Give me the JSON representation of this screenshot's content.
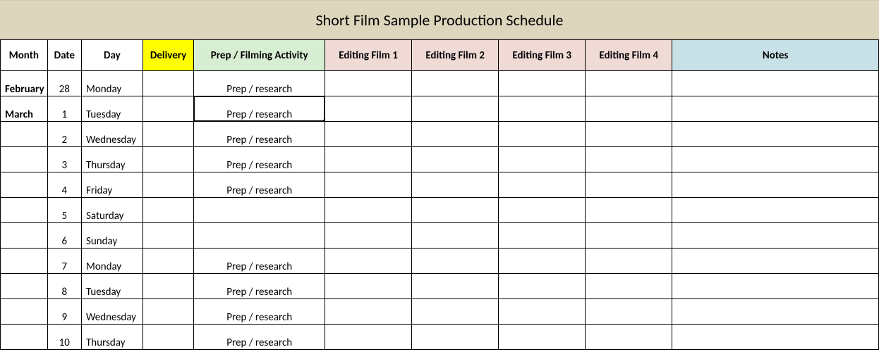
{
  "title": "Short Film Sample Production Schedule",
  "headers": {
    "month": "Month",
    "date": "Date",
    "day": "Day",
    "delivery": "Delivery",
    "activity": "Prep / Filming Activity",
    "edit1": "Editing Film 1",
    "edit2": "Editing Film 2",
    "edit3": "Editing Film 3",
    "edit4": "Editing Film 4",
    "notes": "Notes"
  },
  "rows": [
    {
      "month": "February",
      "date": "28",
      "day": "Monday",
      "delivery": "",
      "activity": "Prep / research",
      "edit1": "",
      "edit2": "",
      "edit3": "",
      "edit4": "",
      "notes": "",
      "selected": false
    },
    {
      "month": "March",
      "date": "1",
      "day": "Tuesday",
      "delivery": "",
      "activity": "Prep / research",
      "edit1": "",
      "edit2": "",
      "edit3": "",
      "edit4": "",
      "notes": "",
      "selected": true
    },
    {
      "month": "",
      "date": "2",
      "day": "Wednesday",
      "delivery": "",
      "activity": "Prep / research",
      "edit1": "",
      "edit2": "",
      "edit3": "",
      "edit4": "",
      "notes": "",
      "selected": false
    },
    {
      "month": "",
      "date": "3",
      "day": "Thursday",
      "delivery": "",
      "activity": "Prep / research",
      "edit1": "",
      "edit2": "",
      "edit3": "",
      "edit4": "",
      "notes": "",
      "selected": false
    },
    {
      "month": "",
      "date": "4",
      "day": "Friday",
      "delivery": "",
      "activity": "Prep / research",
      "edit1": "",
      "edit2": "",
      "edit3": "",
      "edit4": "",
      "notes": "",
      "selected": false
    },
    {
      "month": "",
      "date": "5",
      "day": "Saturday",
      "delivery": "",
      "activity": "",
      "edit1": "",
      "edit2": "",
      "edit3": "",
      "edit4": "",
      "notes": "",
      "selected": false
    },
    {
      "month": "",
      "date": "6",
      "day": "Sunday",
      "delivery": "",
      "activity": "",
      "edit1": "",
      "edit2": "",
      "edit3": "",
      "edit4": "",
      "notes": "",
      "selected": false
    },
    {
      "month": "",
      "date": "7",
      "day": "Monday",
      "delivery": "",
      "activity": "Prep / research",
      "edit1": "",
      "edit2": "",
      "edit3": "",
      "edit4": "",
      "notes": "",
      "selected": false
    },
    {
      "month": "",
      "date": "8",
      "day": "Tuesday",
      "delivery": "",
      "activity": "Prep / research",
      "edit1": "",
      "edit2": "",
      "edit3": "",
      "edit4": "",
      "notes": "",
      "selected": false
    },
    {
      "month": "",
      "date": "9",
      "day": "Wednesday",
      "delivery": "",
      "activity": "Prep / research",
      "edit1": "",
      "edit2": "",
      "edit3": "",
      "edit4": "",
      "notes": "",
      "selected": false
    },
    {
      "month": "",
      "date": "10",
      "day": "Thursday",
      "delivery": "",
      "activity": "Prep / research",
      "edit1": "",
      "edit2": "",
      "edit3": "",
      "edit4": "",
      "notes": "",
      "selected": false
    }
  ]
}
